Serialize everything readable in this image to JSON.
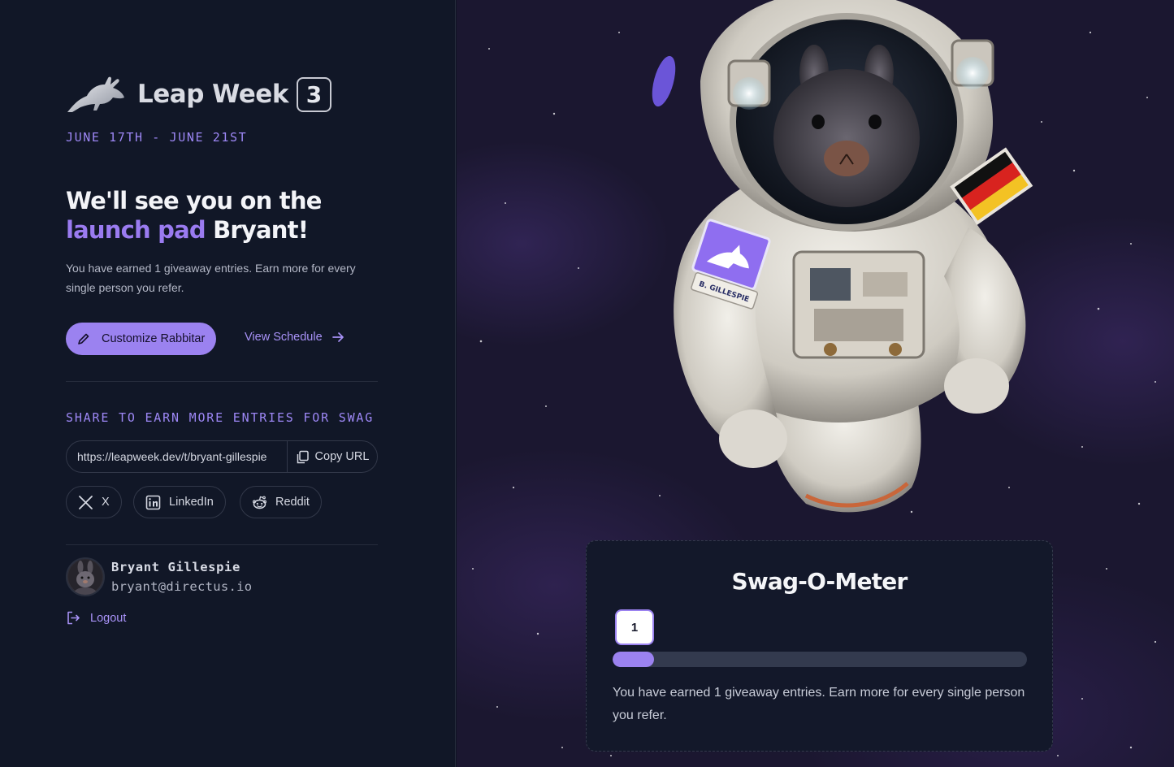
{
  "brand": {
    "title": "Leap Week",
    "edition": "3",
    "dates": "JUNE 17TH - JUNE 21ST"
  },
  "headline": {
    "line1": "We'll see you on the",
    "accent": "launch pad",
    "name": "Bryant!"
  },
  "intro_text": "You have earned 1 giveaway entries. Earn more for every single person you refer.",
  "actions": {
    "customize_label": "Customize Rabbitar",
    "schedule_label": "View Schedule"
  },
  "share": {
    "title": "SHARE TO EARN MORE ENTRIES FOR SWAG",
    "url": "https://leapweek.dev/t/bryant-gillespie",
    "copy_label": "Copy URL",
    "buttons": [
      {
        "label": "X",
        "icon": "x-icon"
      },
      {
        "label": "LinkedIn",
        "icon": "linkedin-icon"
      },
      {
        "label": "Reddit",
        "icon": "reddit-icon"
      }
    ]
  },
  "user": {
    "name": "Bryant Gillespie",
    "email": "bryant@directus.io",
    "logout_label": "Logout"
  },
  "art": {
    "name_patch": "B. GILLESPIE"
  },
  "swag_meter": {
    "title": "Swag-O-Meter",
    "entries": "1",
    "progress": 0.1,
    "text": "You have earned 1 giveaway entries. Earn more for every single person you refer."
  },
  "colors": {
    "accent": "#9b82f0",
    "background": "#111727"
  }
}
